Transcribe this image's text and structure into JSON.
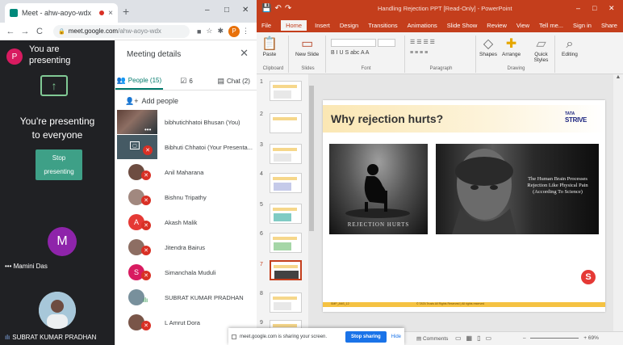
{
  "browser": {
    "tab_title": "Meet - ahw-aoyo-wdx",
    "tab_close": "×",
    "new_tab": "+",
    "url_host": "meet.google.com",
    "url_path": "/ahw-aoyo-wdx",
    "profile_initial": "P",
    "win_min": "–",
    "win_max": "□",
    "win_close": "✕"
  },
  "meet": {
    "presenter_initial": "P",
    "presenter_line1": "You are",
    "presenter_line2": "presenting",
    "share_glyph": "↑",
    "you_presenting_line1": "You're presenting",
    "you_presenting_line2": "to everyone",
    "stop_line1": "Stop",
    "stop_line2": "presenting",
    "tile1_initial": "M",
    "tile1_name": "Mamini Das",
    "tile1_prefix": "•••",
    "tile2_name": "SUBRAT KUMAR PRADHAN"
  },
  "details": {
    "title": "Meeting details",
    "close": "✕",
    "tabs": [
      {
        "icon": "people-icon",
        "label": "People (15)"
      },
      {
        "icon": "checkbox-icon",
        "label": "6"
      },
      {
        "icon": "chat-icon",
        "label": "Chat (2)"
      }
    ],
    "add_people": "Add people",
    "participants": [
      {
        "name": "bibhutichhatoi Bhusan (You)",
        "initial": "",
        "status": "none"
      },
      {
        "name": "Bibhuti Chhatoi  (Your Presenta...",
        "initial": "",
        "status": "muted"
      },
      {
        "name": "Anil Maharana",
        "initial": "",
        "status": "muted"
      },
      {
        "name": "Bishnu Tripathy",
        "initial": "",
        "status": "muted"
      },
      {
        "name": "Akash Malik",
        "initial": "A",
        "status": "muted"
      },
      {
        "name": "Jitendra Bairus",
        "initial": "",
        "status": "muted"
      },
      {
        "name": "Simanchala Muduli",
        "initial": "S",
        "status": "muted"
      },
      {
        "name": "SUBRAT KUMAR PRADHAN",
        "initial": "",
        "status": "speaking"
      },
      {
        "name": "L Amrut Dora",
        "initial": "",
        "status": "muted"
      }
    ]
  },
  "ppt": {
    "doc_title": "Handling Rejection PPT [Read-Only] - PowerPoint",
    "menu": [
      "File",
      "Home",
      "Insert",
      "Design",
      "Transitions",
      "Animations",
      "Slide Show",
      "Review",
      "View",
      "Tell me...",
      "Sign in",
      "Share"
    ],
    "ribbon_groups": [
      "Clipboard",
      "Slides",
      "Font",
      "Paragraph",
      "Drawing",
      "Editing"
    ],
    "ribbon_buttons": {
      "paste": "Paste",
      "new_slide": "New Slide",
      "shapes": "Shapes",
      "arrange": "Arrange",
      "quick_styles": "Quick Styles",
      "editing": "Editing"
    },
    "slide_numbers": [
      "1",
      "2",
      "3",
      "4",
      "5",
      "6",
      "7",
      "8",
      "9"
    ],
    "selected_slide": "7",
    "slide": {
      "title": "Why rejection hurts?",
      "logo_top": "TATA",
      "logo_bottom": "STRIVE",
      "img1_caption": "REJECTION HURTS",
      "img2_caption": "The Human Brain Processes Rejection Like Physical Pain (According To Science)",
      "footer_left": "SMP_ANS_12",
      "footer_mid": "© TATA Trusts All Rights Reserved | All rights reserved",
      "badge": "S"
    },
    "status_comments": "Comments",
    "status_zoom": "69%"
  },
  "sharebar": {
    "message": "meet.google.com is sharing your screen.",
    "stop": "Stop sharing",
    "hide": "Hide"
  }
}
